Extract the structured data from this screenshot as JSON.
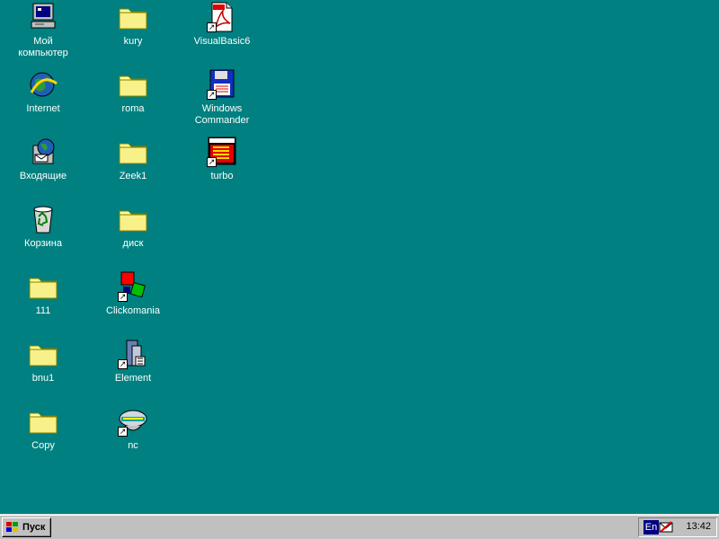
{
  "desktop": {
    "background_color": "#008080",
    "icons": [
      {
        "label": "Мой компьютер",
        "icon": "my-computer-icon"
      },
      {
        "label": "Internet",
        "icon": "internet-icon"
      },
      {
        "label": "Входящие",
        "icon": "inbox-icon"
      },
      {
        "label": "Корзина",
        "icon": "recycle-bin-icon"
      },
      {
        "label": "111",
        "icon": "folder-icon"
      },
      {
        "label": "bnu1",
        "icon": "folder-icon"
      },
      {
        "label": "Copy",
        "icon": "folder-icon"
      },
      {
        "label": "kury",
        "icon": "folder-icon"
      },
      {
        "label": "roma",
        "icon": "folder-icon"
      },
      {
        "label": "Zeek1",
        "icon": "folder-icon"
      },
      {
        "label": "диск",
        "icon": "folder-icon"
      },
      {
        "label": "Clickomania",
        "icon": "clickomania-icon"
      },
      {
        "label": "Element",
        "icon": "element-icon"
      },
      {
        "label": "nc",
        "icon": "norton-commander-icon"
      },
      {
        "label": "VisualBasic6",
        "icon": "pdf-document-icon"
      },
      {
        "label": "Windows Commander",
        "icon": "windows-commander-icon"
      },
      {
        "label": "turbo",
        "icon": "borland-turbo-icon"
      }
    ]
  },
  "taskbar": {
    "start_label": "Пуск",
    "language": "En",
    "clock": "13:42"
  }
}
